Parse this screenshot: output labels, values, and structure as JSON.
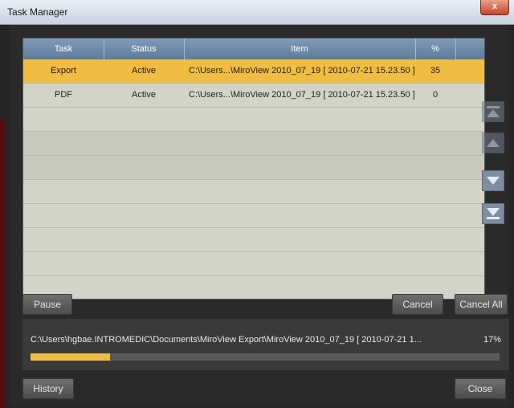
{
  "window": {
    "title": "Task Manager",
    "close_label": "x"
  },
  "table": {
    "columns": [
      "Task",
      "Status",
      "Item",
      "%"
    ],
    "rows": [
      {
        "task": "Export",
        "status": "Active",
        "item": "C:\\Users...\\MiroView 2010_07_19 [ 2010-07-21 15.23.50 ]",
        "percent": "35",
        "selected": true
      },
      {
        "task": "PDF",
        "status": "Active",
        "item": "C:\\Users...\\MiroView 2010_07_19 [ 2010-07-21 15.23.50 ]",
        "percent": "0",
        "selected": false
      }
    ]
  },
  "side_buttons": [
    "move-to-top-icon",
    "move-up-icon",
    "move-down-icon",
    "move-to-bottom-icon"
  ],
  "buttons": {
    "pause": "Pause",
    "cancel": "Cancel",
    "cancel_all": "Cancel All",
    "history": "History",
    "close": "Close"
  },
  "progress": {
    "path": "C:\\Users\\hgbae.INTROMEDIC\\Documents\\MiroView Export\\MiroView 2010_07_19 [ 2010-07-21 1...",
    "percent_label": "17%",
    "value": 0.17
  },
  "colors": {
    "accent": "#f0bd42",
    "header": "#6a87a6",
    "background": "#2a2a2a"
  }
}
